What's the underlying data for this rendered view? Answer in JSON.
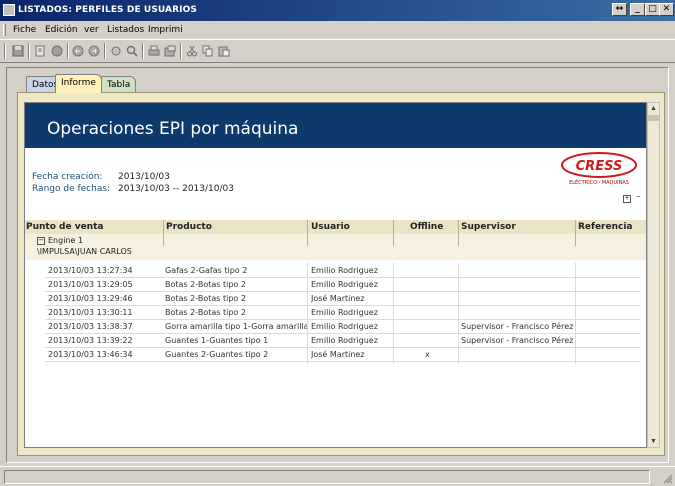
{
  "window": {
    "title": "LISTADOS: PERFILES DE USUARIOS",
    "controls": [
      "↔",
      "_",
      "□",
      "✕"
    ]
  },
  "menu": [
    "Fiche",
    "Edición",
    "ver",
    "Listados",
    "Imprimi"
  ],
  "toolbar": {
    "icons": [
      "save-icon",
      "document-icon",
      "refresh-icon",
      "back-icon",
      "forward-icon",
      "zoom-in-icon",
      "search-icon",
      "print-icon",
      "export-icon",
      "cut-icon",
      "copy-icon",
      "paste-icon"
    ]
  },
  "tabs": [
    {
      "label": "Datos"
    },
    {
      "label": "Informe"
    },
    {
      "label": "Tabla"
    }
  ],
  "report": {
    "title": "Operaciones EPI por máquina",
    "creation_label": "Fecha creación:",
    "creation_value": "2013/10/03",
    "range_label": "Rango de fechas:",
    "range_value": "2013/10/03 -- 2013/10/03",
    "logo_text": "CRESS",
    "logo_subtext": "ELÉCTRICO · MÁQUINAS",
    "expand_all": "+",
    "collapse_all": "−",
    "columns": [
      "Punto de venta",
      "Producto",
      "Usuario",
      "Offline",
      "Supervisor",
      "Referencia"
    ],
    "group": {
      "toggle": "−",
      "line1": "Engine 1",
      "line2": "\\IMPULSA\\JUAN CARLOS"
    },
    "rows": [
      {
        "fecha": "2013/10/03 13:27:34",
        "producto": "Gafas 2-Gafas tipo 2",
        "usuario": "Emilio Rodriguez",
        "offline": "",
        "supervisor": "",
        "referencia": ""
      },
      {
        "fecha": "2013/10/03 13:29:05",
        "producto": "Botas 2-Botas tipo 2",
        "usuario": "Emilio Rodriguez",
        "offline": "",
        "supervisor": "",
        "referencia": ""
      },
      {
        "fecha": "2013/10/03 13:29:46",
        "producto": "Botas 2-Botas tipo 2",
        "usuario": "José Martinez",
        "offline": "",
        "supervisor": "",
        "referencia": ""
      },
      {
        "fecha": "2013/10/03 13:30:11",
        "producto": "Botas 2-Botas tipo 2",
        "usuario": "Emilio Rodriguez",
        "offline": "",
        "supervisor": "",
        "referencia": ""
      },
      {
        "fecha": "2013/10/03 13:38:37",
        "producto": "Gorra amarilla tipo 1-Gorra amarilla",
        "usuario": "Emilio Rodriguez",
        "offline": "",
        "supervisor": "Supervisor - Francisco Pérez",
        "referencia": ""
      },
      {
        "fecha": "2013/10/03 13:39:22",
        "producto": "Guantes 1-Guantes tipo 1",
        "usuario": "Emilio Rodriguez",
        "offline": "",
        "supervisor": "Supervisor - Francisco Pérez",
        "referencia": ""
      },
      {
        "fecha": "2013/10/03 13:46:34",
        "producto": "Guantes 2-Guantes tipo 2",
        "usuario": "José Martinez",
        "offline": "x",
        "supervisor": "",
        "referencia": ""
      }
    ]
  }
}
